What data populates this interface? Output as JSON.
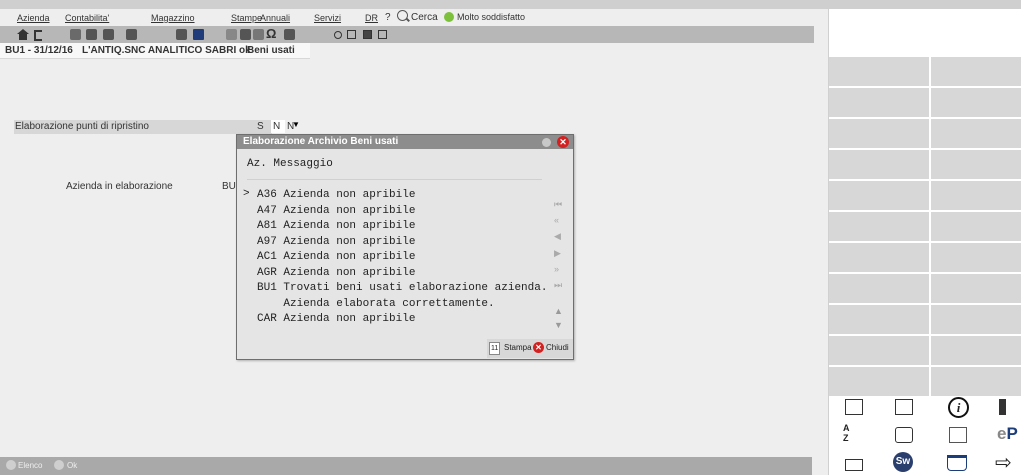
{
  "menu": {
    "azienda": "Azienda",
    "contabilita": "Contabilita'",
    "magazzino": "Magazzino",
    "stampe": "Stampe",
    "annuali": "Annuali",
    "servizi": "Servizi",
    "dr": "DR",
    "help": "?",
    "cerca": "Cerca",
    "mood": "Molto soddisfatto"
  },
  "breadcrumb": {
    "context": "BU1 - 31/12/16",
    "company": "L'ANTIQ.SNC ANALITICO SABRI ok",
    "module": "Beni usati"
  },
  "form": {
    "ripristino_label": "Elaborazione punti di ripristino",
    "opt_s": "S",
    "opt_n": "N",
    "value": "N",
    "azienda_label": "Azienda in elaborazione",
    "azienda_value": "BU"
  },
  "dialog": {
    "title": "Elaborazione Archivio Beni usati",
    "header": "Az. Messaggio",
    "pointer": ">",
    "messages": [
      "A36 Azienda non apribile",
      "A47 Azienda non apribile",
      "A81 Azienda non apribile",
      "A97 Azienda non apribile",
      "AC1 Azienda non apribile",
      "AGR Azienda non apribile",
      "BU1 Trovati beni usati elaborazione azienda.",
      "    Azienda elaborata correttamente.",
      "CAR Azienda non apribile"
    ],
    "stampa_key": "11",
    "stampa": "Stampa",
    "chiudi": "Chiudi"
  },
  "bottom": {
    "elenco": "Elenco",
    "ok": "Ok"
  },
  "right_panel": {
    "sort_top": "A",
    "sort_bottom": "Z",
    "sw": "Sw",
    "ep_e": "e",
    "ep_p": "P"
  }
}
